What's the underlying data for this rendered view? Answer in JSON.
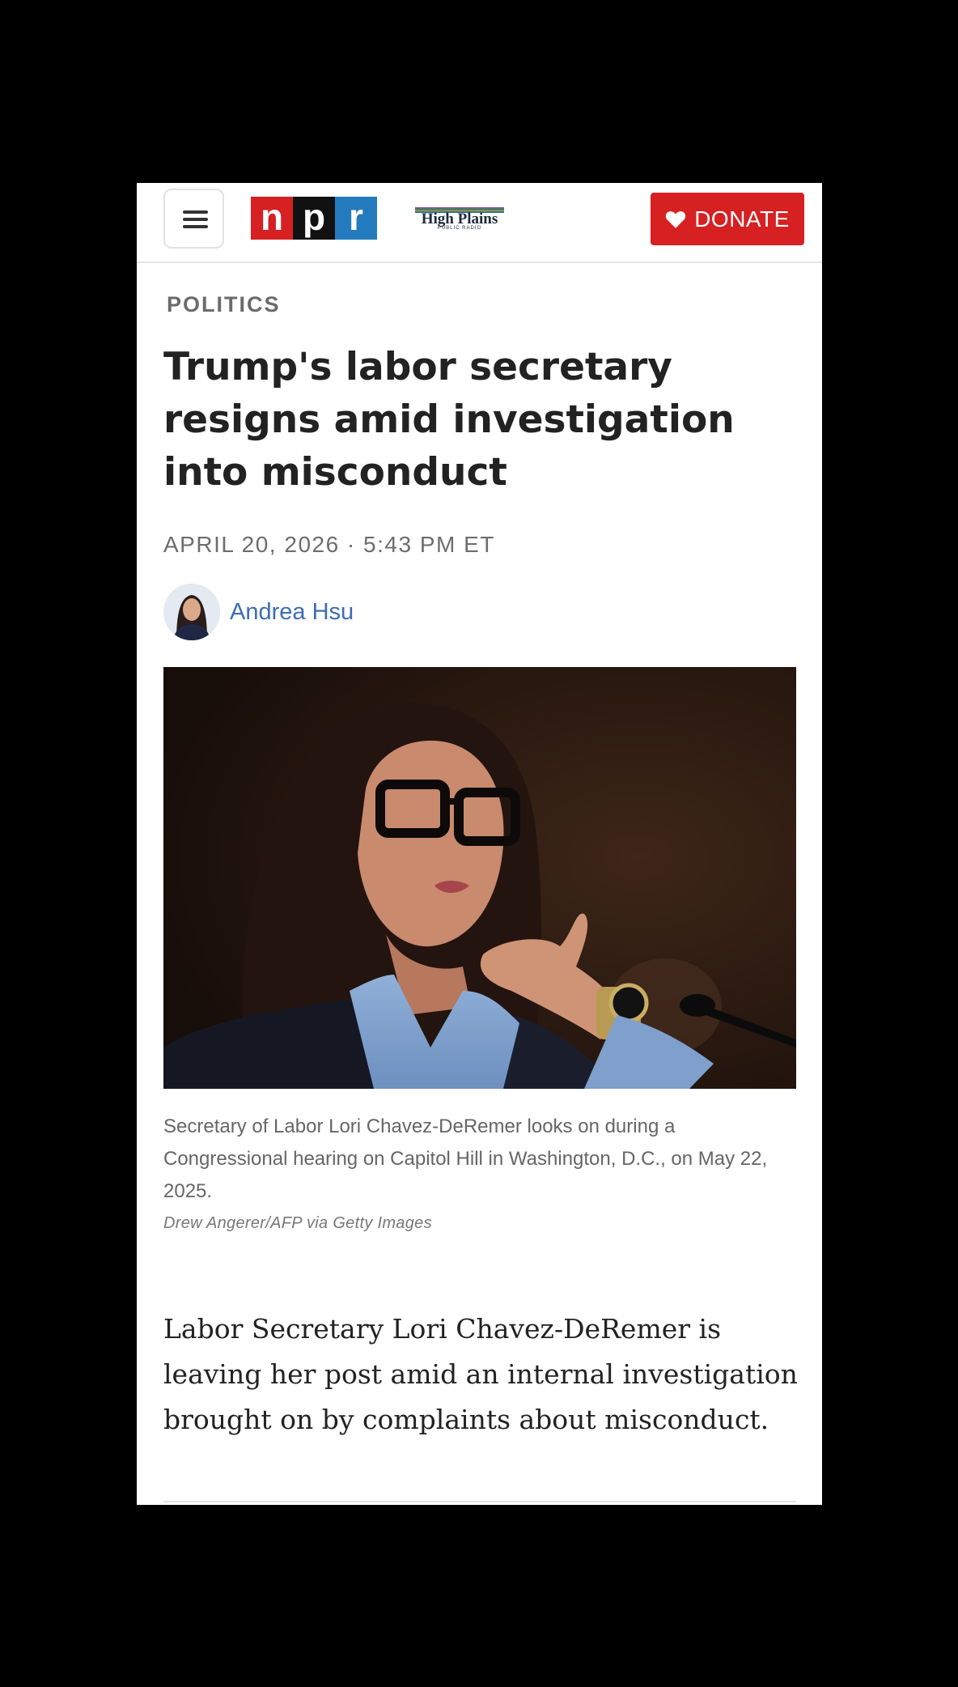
{
  "header": {
    "menu_icon": "hamburger-menu-icon",
    "npr_logo": [
      "n",
      "p",
      "r"
    ],
    "station_logo": {
      "name": "High Plains",
      "subtitle": "PUBLIC RADIO"
    },
    "donate_label": "DONATE",
    "donate_icon": "heart-icon",
    "brand_red": "#d62021",
    "brand_blue": "#237bbd"
  },
  "article": {
    "section": "POLITICS",
    "headline": "Trump's labor secretary resigns amid investigation into misconduct",
    "dateline": "APRIL 20, 2026 · 5:43 PM ET",
    "author": "Andrea Hsu",
    "image_caption": "Secretary of Labor Lori Chavez-DeRemer looks on during a Congressional hearing on Capitol Hill in Washington, D.C., on May 22, 2025.",
    "image_credit": "Drew Angerer/AFP via Getty Images",
    "body_first_paragraph": "Labor Secretary Lori Chavez-DeRemer is leaving her post amid an internal investigation brought on by complaints about misconduct."
  }
}
